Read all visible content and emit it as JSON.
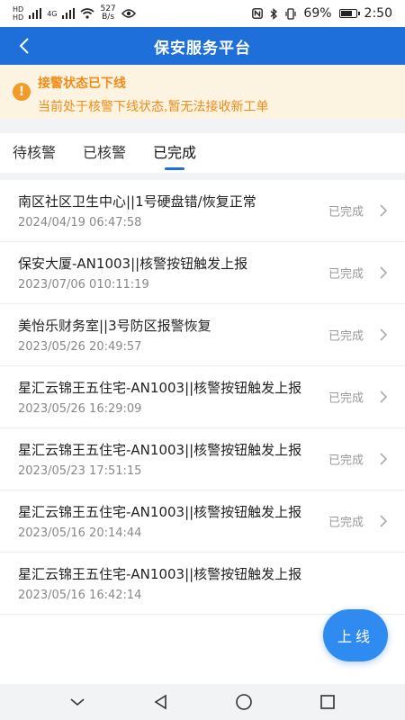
{
  "status_bar": {
    "signal_left_1": "HD",
    "signal_left_2": "HD",
    "net_label": "4G",
    "speed_value": "527",
    "speed_unit": "B/s",
    "battery_percent": "69%",
    "time": "2:50",
    "icons": [
      "nfc-icon",
      "bluetooth-icon",
      "vibrate-icon",
      "battery-icon",
      "wifi-icon",
      "eye-icon"
    ]
  },
  "header": {
    "title": "保安服务平台"
  },
  "warning": {
    "title": "接警状态已下线",
    "message": "当前处于核警下线状态,暂无法接收新工单",
    "color": "#f08c1a"
  },
  "tabs": [
    {
      "label": "待核警",
      "active": false
    },
    {
      "label": "已核警",
      "active": false
    },
    {
      "label": "已完成",
      "active": true
    }
  ],
  "orders": [
    {
      "title": "南区社区卫生中心||1号硬盘错/恢复正常",
      "time": "2024/04/19 06:47:58",
      "status": "已完成"
    },
    {
      "title": "保安大厦-AN1003||核警按钮触发上报",
      "time": "2023/07/06 010:11:19",
      "status": "已完成"
    },
    {
      "title": "美怡乐财务室||3号防区报警恢复",
      "time": "2023/05/26 20:49:57",
      "status": "已完成"
    },
    {
      "title": "星汇云锦王五住宅-AN1003||核警按钮触发上报",
      "time": "2023/05/26 16:29:09",
      "status": "已完成"
    },
    {
      "title": "星汇云锦王五住宅-AN1003||核警按钮触发上报",
      "time": "2023/05/23 17:51:15",
      "status": "已完成"
    },
    {
      "title": "星汇云锦王五住宅-AN1003||核警按钮触发上报",
      "time": "2023/05/16 20:14:44",
      "status": "已完成"
    },
    {
      "title": "星汇云锦王五住宅-AN1003||核警按钮触发上报",
      "time": "2023/05/16 16:42:14",
      "status": ""
    }
  ],
  "fab": {
    "label": "上线",
    "color": "#2f8bf0"
  },
  "accent_color": "#1e6fd9"
}
